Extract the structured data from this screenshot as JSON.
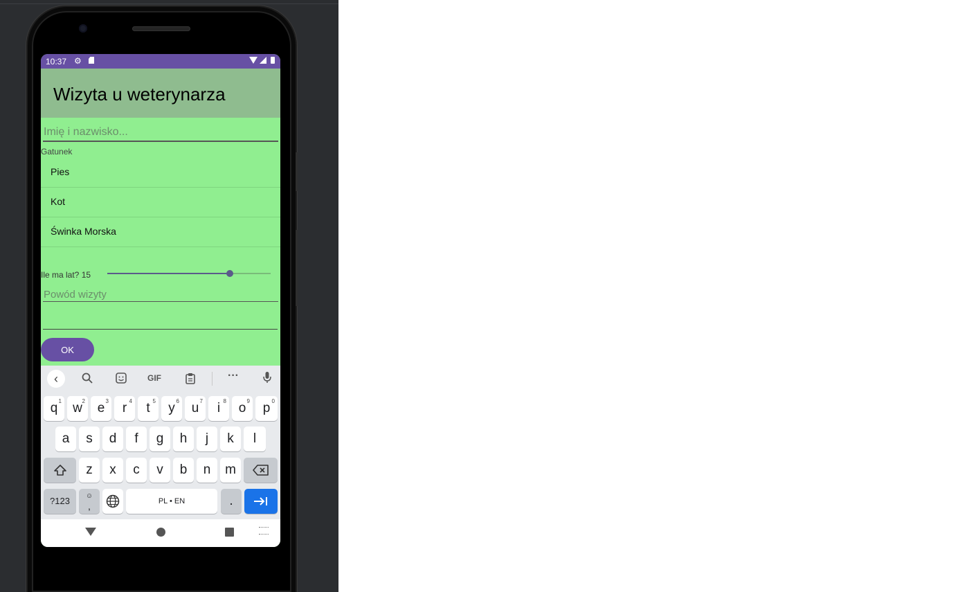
{
  "statusbar": {
    "time": "10:37"
  },
  "app": {
    "title": "Wizyta u weterynarza",
    "name_placeholder": "Imię i nazwisko...",
    "species_label": "Gatunek",
    "species": [
      "Pies",
      "Kot",
      "Świnka Morska"
    ],
    "age_label": "Ile ma lat? 15",
    "age_slider_fraction": 0.75,
    "reason_placeholder": "Powód wizyty",
    "ok_label": "OK"
  },
  "keyboard": {
    "toolbar": {
      "gif_label": "GIF"
    },
    "row1": [
      {
        "k": "q",
        "n": "1"
      },
      {
        "k": "w",
        "n": "2"
      },
      {
        "k": "e",
        "n": "3"
      },
      {
        "k": "r",
        "n": "4"
      },
      {
        "k": "t",
        "n": "5"
      },
      {
        "k": "y",
        "n": "6"
      },
      {
        "k": "u",
        "n": "7"
      },
      {
        "k": "i",
        "n": "8"
      },
      {
        "k": "o",
        "n": "9"
      },
      {
        "k": "p",
        "n": "0"
      }
    ],
    "row2": [
      "a",
      "s",
      "d",
      "f",
      "g",
      "h",
      "j",
      "k",
      "l"
    ],
    "row3": [
      "z",
      "x",
      "c",
      "v",
      "b",
      "n",
      "m"
    ],
    "symbols_label": "?123",
    "comma_label": ",",
    "space_label": "PL • EN",
    "period_label": "."
  },
  "colors": {
    "primary": "#6750a4",
    "screen_bg": "#90ee90",
    "appbar_bg": "#8fbc8f",
    "enter_key": "#1a73e8"
  }
}
